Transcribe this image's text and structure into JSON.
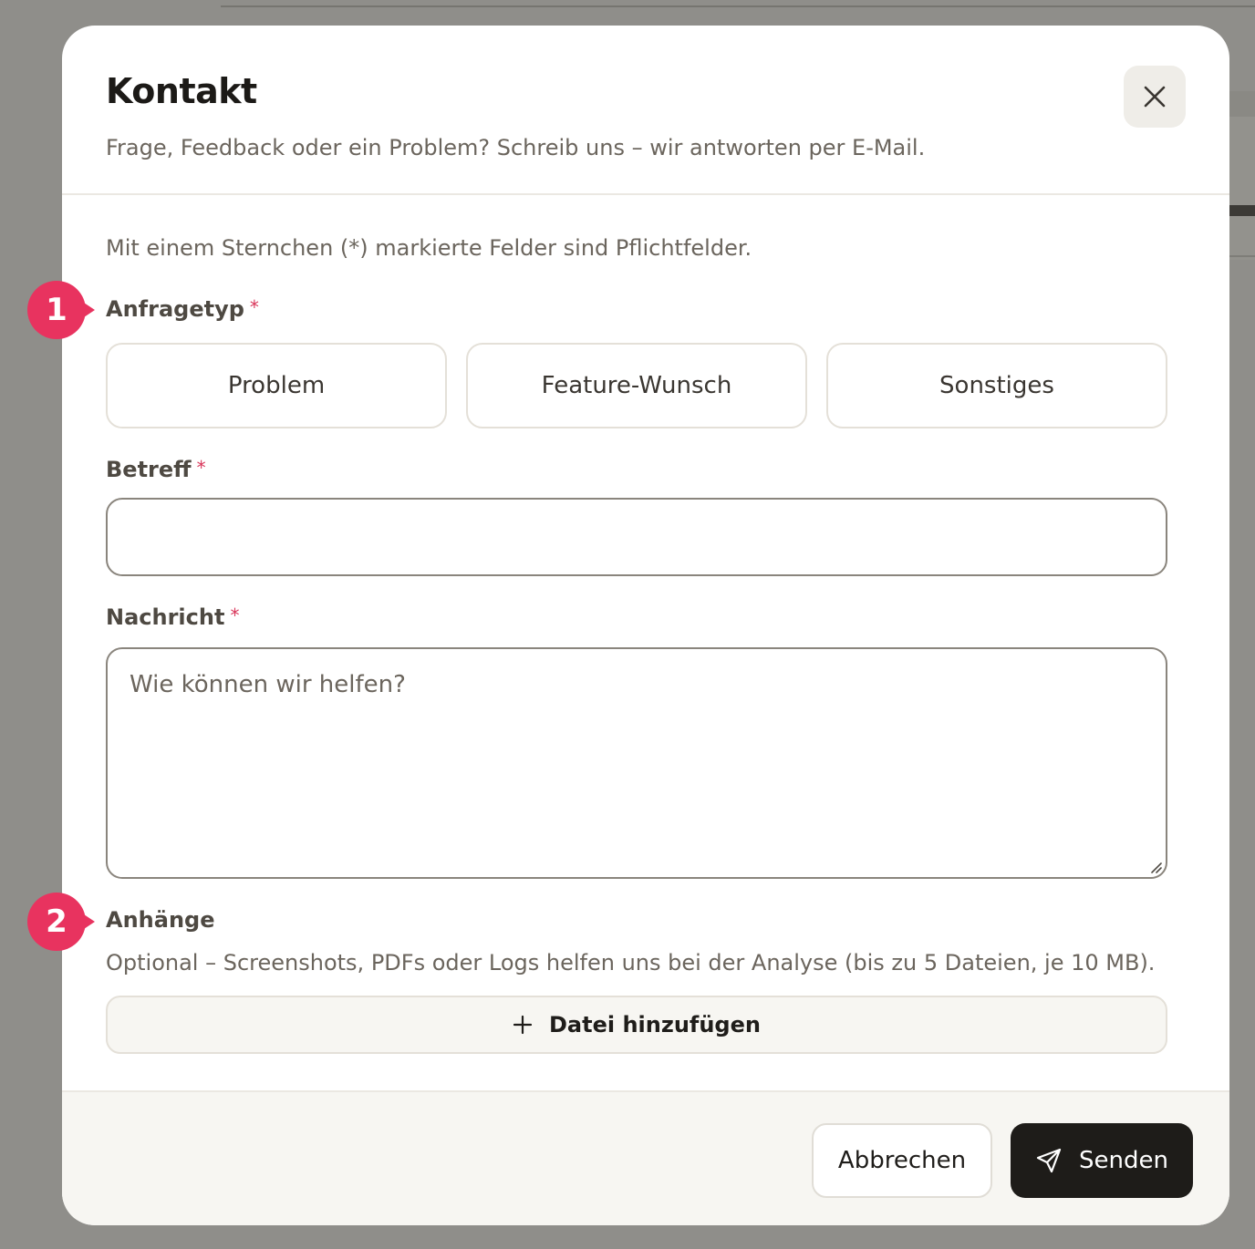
{
  "dialog": {
    "title": "Kontakt",
    "subtitle": "Frage, Feedback oder ein Problem? Schreib uns – wir antworten per E-Mail.",
    "close_icon": "close-icon"
  },
  "form": {
    "required_note": "Mit einem Sternchen (*) markierte Felder sind Pflichtfelder.",
    "request_type": {
      "label": "Anfragetyp",
      "required_mark": "*",
      "options": [
        "Problem",
        "Feature-Wunsch",
        "Sonstiges"
      ]
    },
    "subject": {
      "label": "Betreff",
      "required_mark": "*",
      "value": ""
    },
    "message": {
      "label": "Nachricht",
      "required_mark": "*",
      "placeholder": "Wie können wir helfen?"
    },
    "attachments": {
      "label": "Anhänge",
      "help": "Optional – Screenshots, PDFs oder Logs helfen uns bei der Analyse (bis zu 5 Dateien, je 10 MB).",
      "add_label": "Datei hinzufügen",
      "add_icon": "plus-icon"
    }
  },
  "footer": {
    "cancel_label": "Abbrechen",
    "send_label": "Senden",
    "send_icon": "send-icon"
  },
  "markers": [
    "1",
    "2"
  ],
  "colors": {
    "accent": "#e8335f",
    "primary_button": "#1e1c19",
    "overlay": "#8f8e8a"
  }
}
